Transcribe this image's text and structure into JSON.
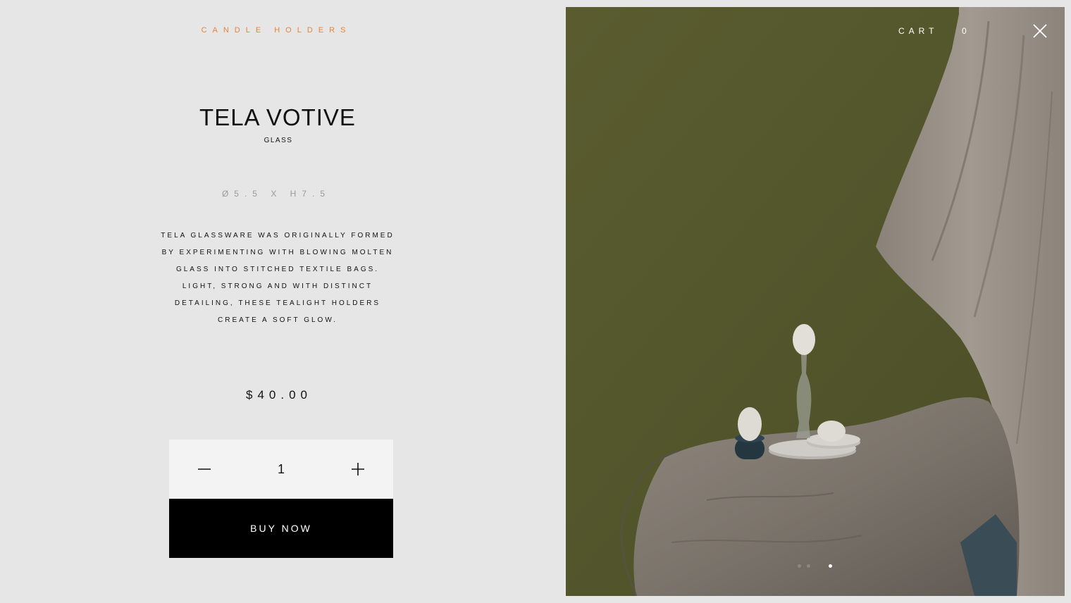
{
  "product": {
    "category": "CANDLE HOLDERS",
    "title": "TELA VOTIVE",
    "material": "GLASS",
    "dimensions": "Ø5.5 X H7.5",
    "description": "TELA GLASSWARE WAS ORIGINALLY FORMED BY EXPERIMENTING WITH BLOWING MOLTEN GLASS INTO STITCHED TEXTILE BAGS. LIGHT, STRONG AND WITH DISTINCT DETAILING, THESE TEALIGHT HOLDERS CREATE A SOFT GLOW.",
    "price": "$40.00"
  },
  "quantity": {
    "value": "1",
    "minus_icon": "minus-icon",
    "plus_icon": "plus-icon"
  },
  "buy_button": {
    "label": "BUY NOW"
  },
  "header": {
    "cart_label": "CART",
    "cart_count": "0",
    "close_icon": "close-icon"
  },
  "gallery": {
    "slide_count": 3,
    "active_slide": 3
  },
  "colors": {
    "accent": "#e8833a",
    "background": "#e6e6e6",
    "button_bg": "#000000",
    "qty_bg": "#f3f3f3",
    "wall_green": "#555a2a"
  }
}
